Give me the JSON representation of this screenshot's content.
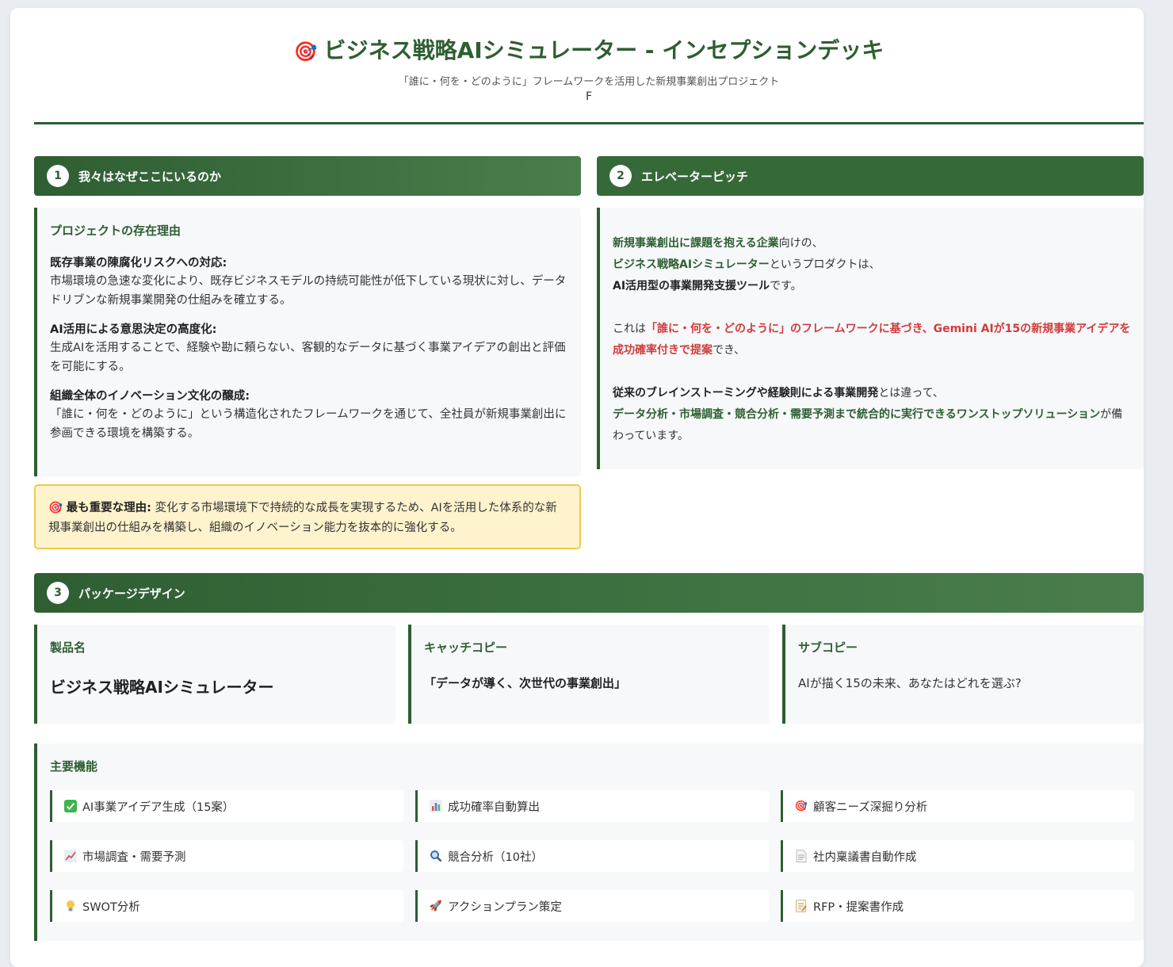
{
  "header": {
    "title": "ビジネス戦略AIシミュレーター - インセプションデッキ",
    "subtitle": "「誰に・何を・どのように」フレームワークを活用した新規事業創出プロジェクト",
    "subline": "F"
  },
  "section1": {
    "num": "1",
    "title": "我々はなぜここにいるのか",
    "panel_title": "プロジェクトの存在理由",
    "reasons": [
      {
        "title": "既存事業の陳腐化リスクへの対応:",
        "desc": "市場環境の急速な変化により、既存ビジネスモデルの持続可能性が低下している現状に対し、データドリブンな新規事業開発の仕組みを確立する。"
      },
      {
        "title": "AI活用による意思決定の高度化:",
        "desc": "生成AIを活用することで、経験や勘に頼らない、客観的なデータに基づく事業アイデアの創出と評価を可能にする。"
      },
      {
        "title": "組織全体のイノベーション文化の醸成:",
        "desc": "「誰に・何を・どのように」という構造化されたフレームワークを通じて、全社員が新規事業創出に参画できる環境を構築する。"
      }
    ],
    "important_label": "最も重要な理由:",
    "important_text": " 変化する市場環境下で持続的な成長を実現するため、AIを活用した体系的な新規事業創出の仕組みを構築し、組織のイノベーション能力を抜本的に強化する。"
  },
  "section2": {
    "num": "2",
    "title": "エレベーターピッチ",
    "p1_a": "新規事業創出に課題を抱える企業",
    "p1_b": "向けの、",
    "p2_a": "ビジネス戦略AIシミュレーター",
    "p2_b": "というプロダクトは、",
    "p3_a": "AI活用型の事業開発支援ツール",
    "p3_b": "です。",
    "p4_a": "これは",
    "p4_b": "「誰に・何を・どのように」のフレームワークに基づき、Gemini AIが15の新規事業アイデアを成功確率付きで提案",
    "p4_c": "でき、",
    "p5_a": "従来のブレインストーミングや経験則による事業開発",
    "p5_b": "とは違って、",
    "p6_a": "データ分析・市場調査・競合分析・需要予測まで統合的に実行できるワンストップソリューション",
    "p6_b": "が備わっています。"
  },
  "section3": {
    "num": "3",
    "title": "パッケージデザイン",
    "product_label": "製品名",
    "product_name": "ビジネス戦略AIシミュレーター",
    "catch_label": "キャッチコピー",
    "catch_copy": "「データが導く、次世代の事業創出」",
    "sub_label": "サブコピー",
    "sub_copy": "AIが描く15の未来、あなたはどれを選ぶ?",
    "features_title": "主要機能",
    "features": [
      {
        "icon": "check-icon",
        "label": "AI事業アイデア生成（15案）"
      },
      {
        "icon": "bar-chart-icon",
        "label": "成功確率自動算出"
      },
      {
        "icon": "target-icon",
        "label": "顧客ニーズ深掘り分析"
      },
      {
        "icon": "line-chart-icon",
        "label": "市場調査・需要予測"
      },
      {
        "icon": "magnifier-icon",
        "label": "競合分析（10社）"
      },
      {
        "icon": "document-icon",
        "label": "社内稟議書自動作成"
      },
      {
        "icon": "lightbulb-icon",
        "label": "SWOT分析"
      },
      {
        "icon": "rocket-icon",
        "label": "アクションプラン策定"
      },
      {
        "icon": "memo-icon",
        "label": "RFP・提案書作成"
      }
    ]
  },
  "colors": {
    "primary": "#2e5e32",
    "highlight_red": "#d23b3b",
    "callout_bg": "#fff3cd",
    "callout_border": "#f2c94c"
  }
}
